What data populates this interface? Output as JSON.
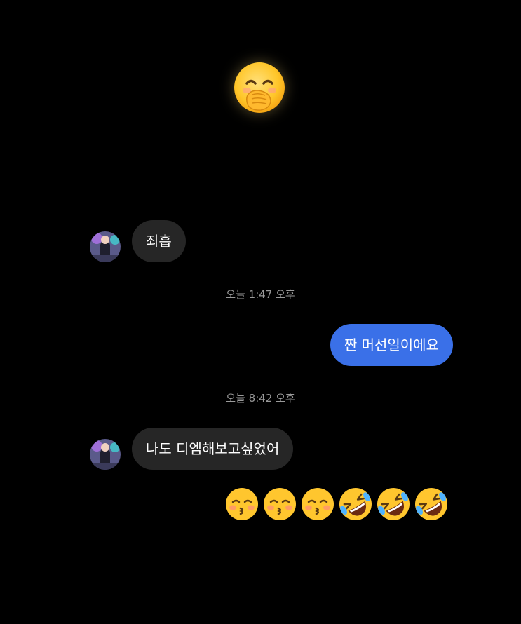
{
  "chat": {
    "reaction_icon": "hand-over-mouth-emoji",
    "messages": [
      {
        "direction": "incoming",
        "text": "죄흡"
      },
      {
        "timestamp": "오늘 1:47 오후"
      },
      {
        "direction": "outgoing",
        "text": "짠 머선일이에요"
      },
      {
        "timestamp": "오늘 8:42 오후"
      },
      {
        "direction": "incoming",
        "text": "나도 디엠해보고싶었어"
      },
      {
        "direction": "incoming",
        "emojis": [
          "kissing-closed-eyes",
          "kissing-closed-eyes",
          "kissing-closed-eyes",
          "rofl",
          "rofl",
          "rofl"
        ]
      }
    ]
  },
  "colors": {
    "background": "#000000",
    "incoming_bubble": "#262626",
    "outgoing_bubble": "#3a70e8",
    "timestamp": "#9a9a9a"
  }
}
